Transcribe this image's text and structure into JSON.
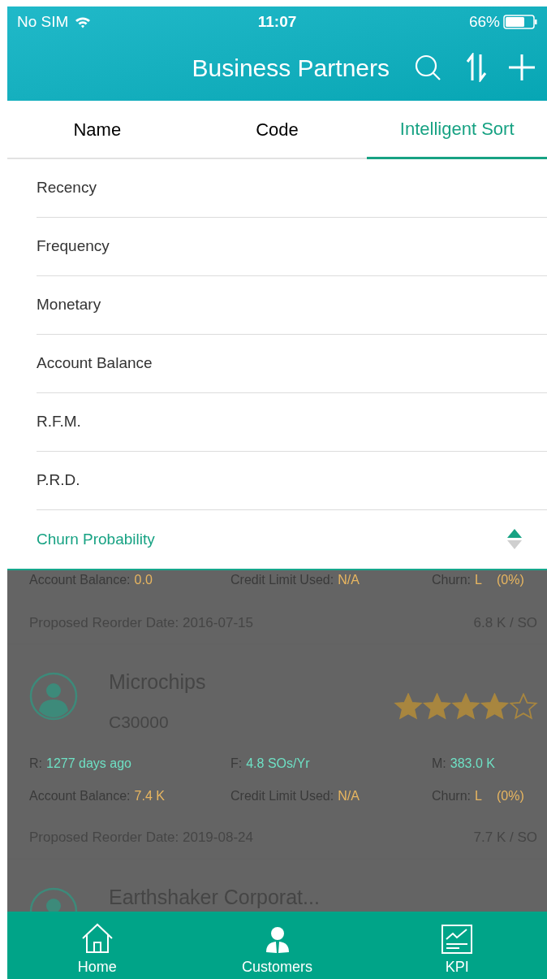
{
  "status_bar": {
    "carrier": "No SIM",
    "time": "11:07",
    "battery": "66%"
  },
  "header": {
    "title": "Business Partners"
  },
  "tabs": [
    {
      "label": "Name",
      "selected": false
    },
    {
      "label": "Code",
      "selected": false
    },
    {
      "label": "Intelligent Sort",
      "selected": true
    }
  ],
  "sort_menu": {
    "ascending": true,
    "items": [
      {
        "label": "Recency",
        "selected": false
      },
      {
        "label": "Frequency",
        "selected": false
      },
      {
        "label": "Monetary",
        "selected": false
      },
      {
        "label": "Account Balance",
        "selected": false
      },
      {
        "label": "R.F.M.",
        "selected": false
      },
      {
        "label": "P.R.D.",
        "selected": false
      },
      {
        "label": "Churn Probability",
        "selected": true
      }
    ]
  },
  "customers": [
    {
      "metric_rows": [
        [
          {
            "label": "Account Balance:",
            "value": "0.0",
            "color": "#e8b660"
          },
          {
            "label": "Credit Limit Used:",
            "value": "N/A",
            "color": "#e8b660"
          },
          {
            "label": "Churn:",
            "value": "L",
            "extra": "(0%)",
            "color": "#e8b660"
          }
        ]
      ],
      "reorder": "Proposed Reorder Date: 2016-07-15",
      "per_so": "6.8 K / SO"
    },
    {
      "name": "Microchips",
      "code": "C30000",
      "stars": 4,
      "metric_rows": [
        [
          {
            "label": "R:",
            "value": "1277 days ago",
            "color": "#6ee0c4"
          },
          {
            "label": "F:",
            "value": "4.8 SOs/Yr",
            "color": "#6ee0c4"
          },
          {
            "label": "M:",
            "value": "383.0 K",
            "color": "#6ee0c4"
          }
        ],
        [
          {
            "label": "Account Balance:",
            "value": "7.4 K",
            "color": "#e8b660"
          },
          {
            "label": "Credit Limit Used:",
            "value": "N/A",
            "color": "#e8b660"
          },
          {
            "label": "Churn:",
            "value": "L",
            "extra": "(0%)",
            "color": "#e8b660"
          }
        ]
      ],
      "reorder": "Proposed Reorder Date: 2019-08-24",
      "per_so": "7.7 K / SO"
    },
    {
      "name": "Earthshaker Corporat..."
    }
  ],
  "bottom_nav": [
    {
      "label": "Home",
      "kind": "home"
    },
    {
      "label": "Customers",
      "kind": "customers"
    },
    {
      "label": "KPI",
      "kind": "kpi"
    }
  ]
}
